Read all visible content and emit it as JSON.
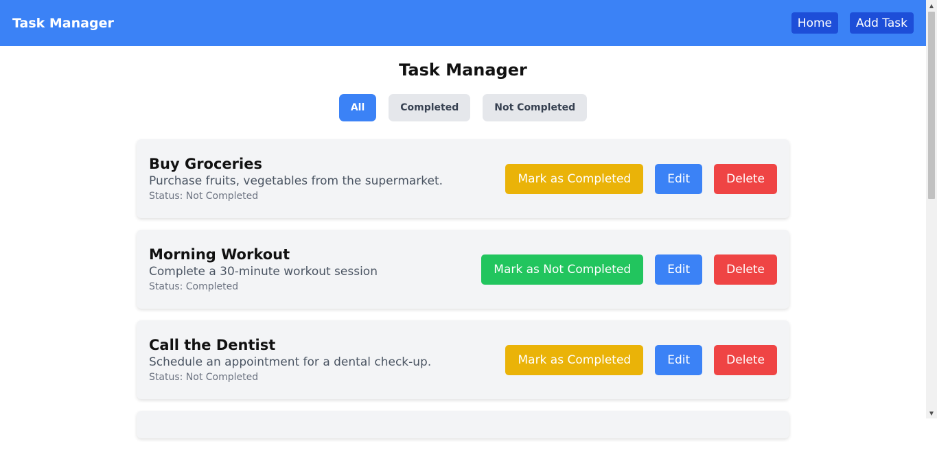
{
  "navbar": {
    "brand": "Task Manager",
    "links": [
      "Home",
      "Add Task"
    ]
  },
  "page": {
    "title": "Task Manager"
  },
  "filters": [
    {
      "label": "All",
      "active": true
    },
    {
      "label": "Completed",
      "active": false
    },
    {
      "label": "Not Completed",
      "active": false
    }
  ],
  "tasks": [
    {
      "title": "Buy Groceries",
      "description": "Purchase fruits, vegetables from the supermarket.",
      "status": "Status: Not Completed",
      "toggle_label": "Mark as Completed",
      "toggle_color": "#eab308",
      "edit_label": "Edit",
      "delete_label": "Delete"
    },
    {
      "title": "Morning Workout",
      "description": "Complete a 30-minute workout session",
      "status": "Status: Completed",
      "toggle_label": "Mark as Not Completed",
      "toggle_color": "#22c55e",
      "edit_label": "Edit",
      "delete_label": "Delete"
    },
    {
      "title": "Call the Dentist",
      "description": "Schedule an appointment for a dental check-up.",
      "status": "Status: Not Completed",
      "toggle_label": "Mark as Completed",
      "toggle_color": "#eab308",
      "edit_label": "Edit",
      "delete_label": "Delete"
    }
  ],
  "colors": {
    "navbar": "#3b82f6",
    "nav_button": "#1d4ed8",
    "edit": "#3b82f6",
    "delete": "#ef4444",
    "mark_completed": "#eab308",
    "mark_not_completed": "#22c55e"
  }
}
